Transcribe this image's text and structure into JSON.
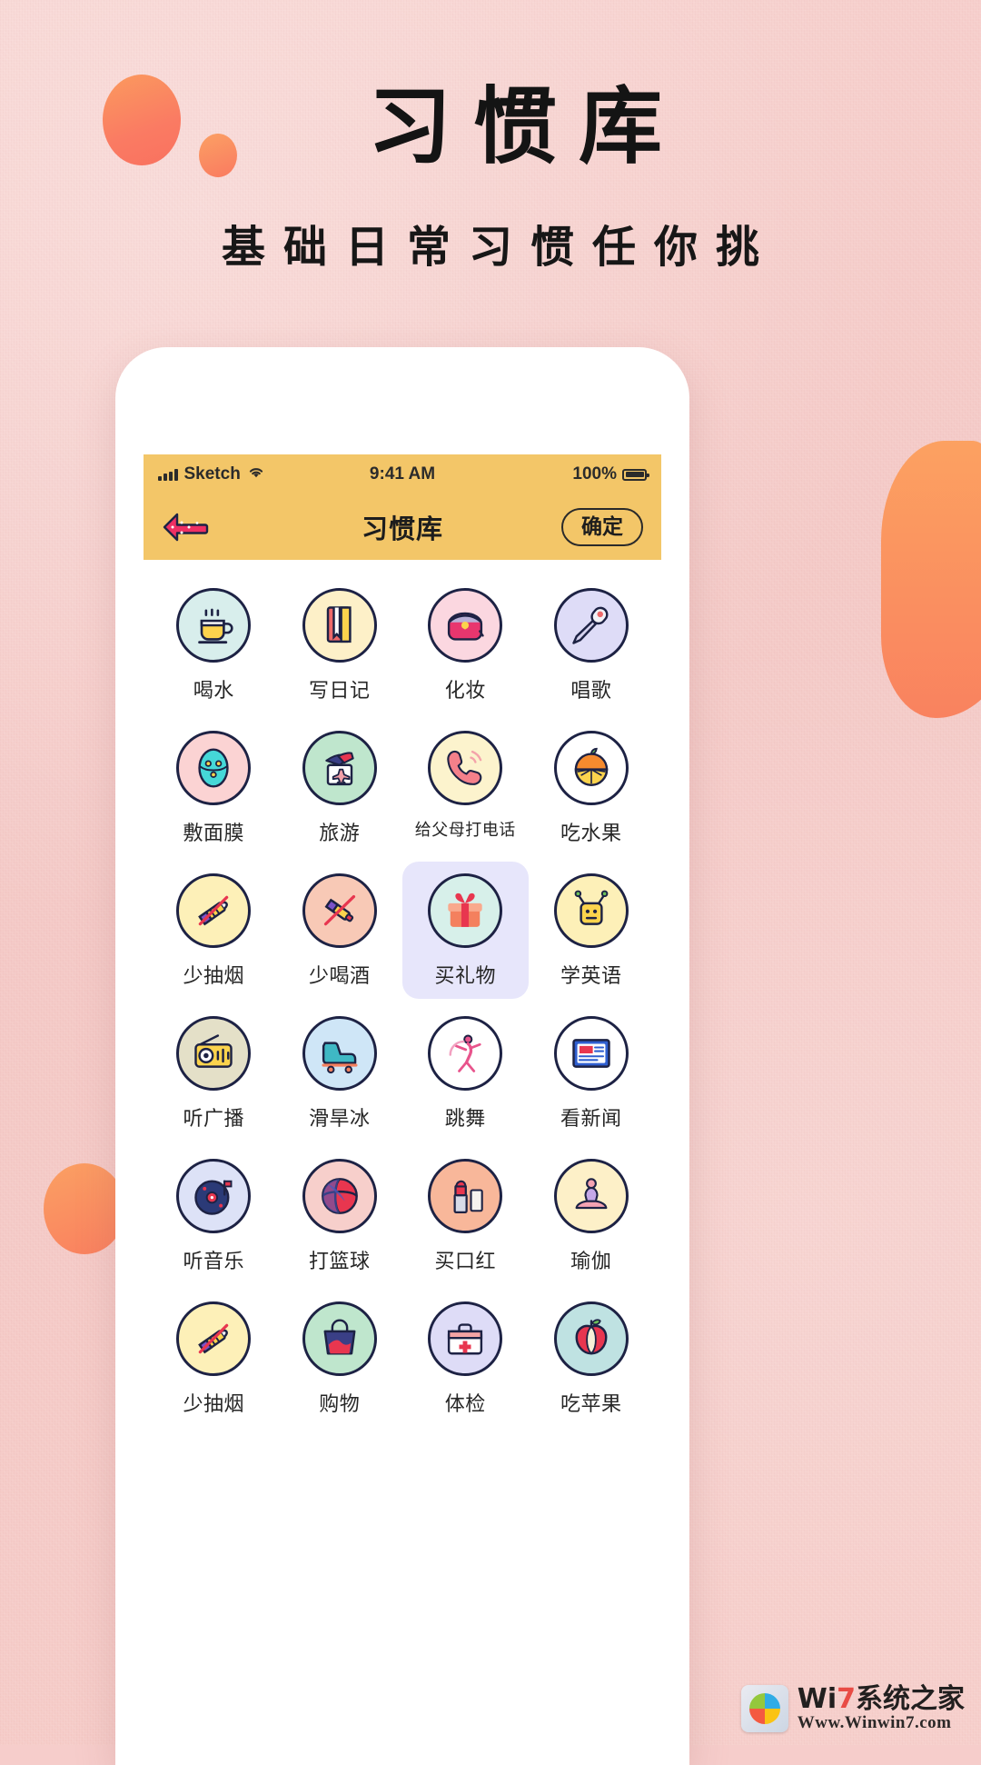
{
  "hero": {
    "title": "习惯库",
    "subtitle": "基础日常习惯任你挑"
  },
  "colors": {
    "background": "#f6cdcb",
    "accent_orange": "#fa7f5f",
    "header_yellow": "#f3c668",
    "selected_lavender": "#e7e6fb",
    "outline_navy": "#1d2244",
    "back_arrow_pink": "#ef2f63"
  },
  "status_bar": {
    "carrier": "Sketch",
    "time": "9:41 AM",
    "battery_percent": "100%",
    "icons": [
      "signal-bars-icon",
      "wifi-icon",
      "battery-icon"
    ]
  },
  "nav_bar": {
    "back_icon": "back-arrow-icon",
    "title": "习惯库",
    "confirm_label": "确定"
  },
  "grid": {
    "selected_index": 10,
    "items": [
      {
        "label": "喝水",
        "icon": "cup-icon",
        "bg": "#d8eeec"
      },
      {
        "label": "写日记",
        "icon": "book-icon",
        "bg": "#fdf0c8"
      },
      {
        "label": "化妆",
        "icon": "purse-icon",
        "bg": "#fbd7e0"
      },
      {
        "label": "唱歌",
        "icon": "microphone-icon",
        "bg": "#dedcf7"
      },
      {
        "label": "敷面膜",
        "icon": "face-mask-icon",
        "bg": "#fbd3d3"
      },
      {
        "label": "旅游",
        "icon": "travel-icon",
        "bg": "#bfe6cd"
      },
      {
        "label": "给父母打电话",
        "icon": "phone-call-icon",
        "bg": "#fcf3cd"
      },
      {
        "label": "吃水果",
        "icon": "orange-icon",
        "bg": "#ffffff"
      },
      {
        "label": "少抽烟",
        "icon": "no-smoking-icon",
        "bg": "#fdf0b8"
      },
      {
        "label": "少喝酒",
        "icon": "no-alcohol-icon",
        "bg": "#f8c9b6"
      },
      {
        "label": "买礼物",
        "icon": "gift-icon",
        "bg": "#d7f0ea"
      },
      {
        "label": "学英语",
        "icon": "english-icon",
        "bg": "#fdf0b8"
      },
      {
        "label": "听广播",
        "icon": "radio-icon",
        "bg": "#e4e0c8"
      },
      {
        "label": "滑旱冰",
        "icon": "skate-icon",
        "bg": "#cfe6f7"
      },
      {
        "label": "跳舞",
        "icon": "dance-icon",
        "bg": "#ffffff"
      },
      {
        "label": "看新闻",
        "icon": "news-icon",
        "bg": "#ffffff"
      },
      {
        "label": "听音乐",
        "icon": "vinyl-icon",
        "bg": "#dde2f7"
      },
      {
        "label": "打篮球",
        "icon": "basketball-icon",
        "bg": "#f7cfcb"
      },
      {
        "label": "买口红",
        "icon": "lipstick-icon",
        "bg": "#f8b79a"
      },
      {
        "label": "瑜伽",
        "icon": "yoga-icon",
        "bg": "#fdf0c8"
      },
      {
        "label": "少抽烟",
        "icon": "no-smoking-icon",
        "bg": "#fdf0b8"
      },
      {
        "label": "购物",
        "icon": "shopping-bag-icon",
        "bg": "#bfe6cd"
      },
      {
        "label": "体检",
        "icon": "medical-kit-icon",
        "bg": "#dedcf7"
      },
      {
        "label": "吃苹果",
        "icon": "apple-icon",
        "bg": "#bfe2e2"
      }
    ]
  },
  "watermark": {
    "brand_prefix": "Wi",
    "brand_accent": "7",
    "brand_suffix": "系统之家",
    "url": "Www.Winwin7.com"
  }
}
